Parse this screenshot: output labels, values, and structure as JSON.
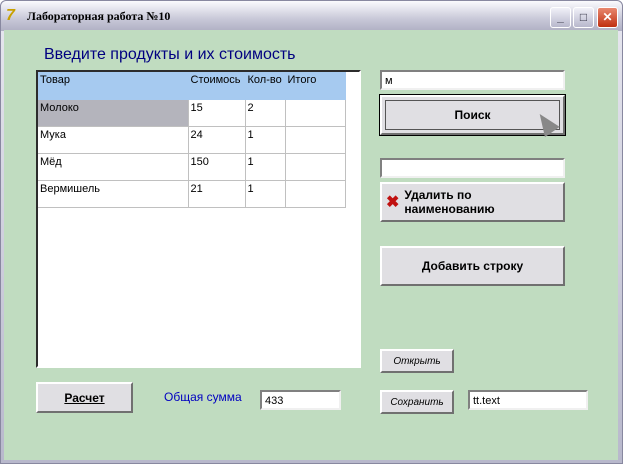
{
  "window": {
    "title": "Лабораторная работа №10",
    "minimize": "_",
    "maximize": "□",
    "close": "✕"
  },
  "heading": "Введите продукты и их стоимость",
  "grid": {
    "columns": [
      "Товар",
      "Стоимось",
      "Кол-во",
      "Итого"
    ],
    "rows": [
      [
        "Молоко",
        "15",
        "2",
        ""
      ],
      [
        "Мука",
        "24",
        "1",
        ""
      ],
      [
        "Мёд",
        "150",
        "1",
        ""
      ],
      [
        "Вермишель",
        "21",
        "1",
        ""
      ]
    ]
  },
  "search": {
    "value": "м",
    "button": "Поиск"
  },
  "delete": {
    "value": "",
    "button": "Удалить по наименованию"
  },
  "add_button": "Добавить строку",
  "open_button": "Открыть",
  "save": {
    "button": "Сохранить",
    "filename": "tt.text"
  },
  "calc_button": "Расчет",
  "total": {
    "label": "Общая сумма",
    "value": "433"
  }
}
